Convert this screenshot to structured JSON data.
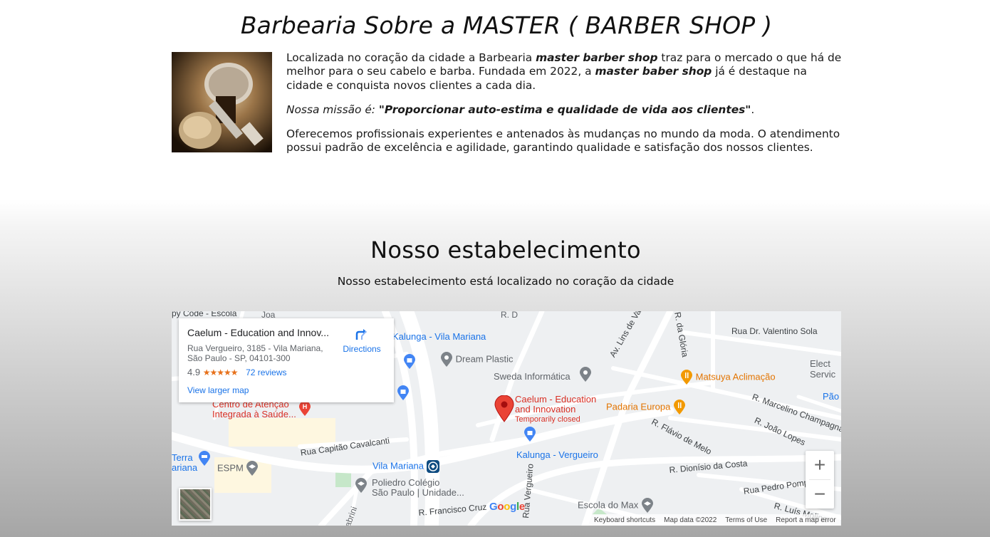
{
  "about": {
    "title": "Barbearia Sobre a MASTER ( BARBER SHOP )",
    "p1_a": "Localizada no coração da cidade a Barbearia ",
    "p1_b": "master barber shop",
    "p1_c": " traz para o mercado o que há de melhor para o seu cabelo e barba. Fundada em 2022, a ",
    "p1_d": "master baber shop",
    "p1_e": " já é destaque na cidade e conquista novos clientes a cada dia.",
    "p2_a": "Nossa missão é: ",
    "p2_b": "\"Proporcionar auto-estima e qualidade de vida aos clientes\"",
    "p2_c": ".",
    "p3": "Oferecemos profissionais experientes e antenados às mudanças no mundo da moda. O atendimento possui padrão de excelência e agilidade, garantindo qualidade e satisfação dos nossos clientes."
  },
  "location": {
    "title": "Nosso estabelecimento",
    "subtitle": "Nosso estabelecimento está localizado no coração da cidade"
  },
  "map": {
    "card": {
      "name": "Caelum - Education and Innov...",
      "address1": "Rua Vergueiro, 3185 - Vila Mariana,",
      "address2": "São Paulo - SP, 04101-300",
      "rating": "4.9",
      "stars": "★★★★★",
      "reviews": "72 reviews",
      "larger": "View larger map",
      "directions": "Directions"
    },
    "marker": {
      "name1": "Caelum - Education",
      "name2": "and Innovation",
      "status": "Temporarily closed"
    },
    "pois": {
      "kalunga_vm": "Kalunga - Vila Mariana",
      "dream_plastic": "Dream Plastic",
      "sweda": "Sweda Informática",
      "matsuya": "Matsuya Aclimação",
      "padaria": "Padaria Europa",
      "centro1": "Centro de Atenção",
      "centro2": "Integrada à Saúde...",
      "terra1": "Terra",
      "terra2": "ariana",
      "espm": "ESPM",
      "vila_mariana": "Vila Mariana",
      "kalunga_v": "Kalunga - Vergueiro",
      "poliedro1": "Poliedro Colégio",
      "poliedro2": "São Paulo | Unidade...",
      "escola_max": "Escola do Max",
      "py_code": "py Code - Escola",
      "elect1": "Elect",
      "elect2": "Servic",
      "pao": "Pão"
    },
    "streets": {
      "valentino": "Rua Dr. Valentino Sola",
      "lins": "Av. Lins de Vasconcelos",
      "gloria": "R. da Glória",
      "marcelino": "R. Marcelino Champagnat",
      "joao_lopes": "R. João Lopes",
      "flavio": "R. Flávio de Melo",
      "dionisio": "R. Dionísio da Costa",
      "pedro": "Rua Pedro Pomp",
      "luis": "R. Luís Molina",
      "capitao": "Rua Capitão Cavalcanti",
      "vergueiro": "Rua Vergueiro",
      "francisco": "R. Francisco Cruz",
      "brini": "abrini",
      "r_d": "R. D",
      "r_ss": "R.",
      "joa": "Joa"
    },
    "google": "Google",
    "attribution": [
      "Keyboard shortcuts",
      "Map data ©2022",
      "Terms of Use",
      "Report a map error"
    ],
    "zoom_in": "+",
    "zoom_out": "−"
  },
  "colors": {
    "marker_red": "#ea4335",
    "poi_blue": "#4285f4",
    "poi_orange": "#f29900",
    "link_blue": "#1a73e8"
  }
}
